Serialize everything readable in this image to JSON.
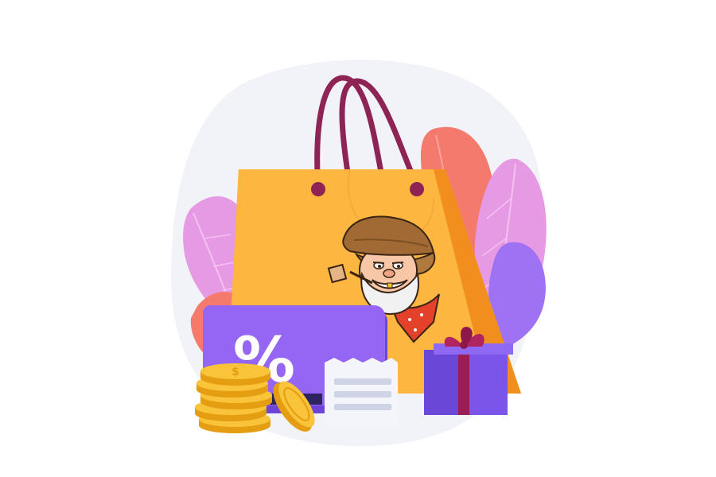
{
  "illustration": {
    "card_symbol": "%",
    "coin_symbol": "$",
    "icons": [
      "shopping-bag-icon",
      "discount-card-icon",
      "gold-coin-stack-icon",
      "receipt-icon",
      "gift-box-icon",
      "prospector-mascot-icon",
      "leaf-decoration-icon"
    ]
  },
  "colors": {
    "background_blob": "#f2f3f8",
    "bag_front": "#fdb63f",
    "bag_side": "#f59a25",
    "bag_handle": "#8e2455",
    "leaf_pink": "#ec8fe0",
    "leaf_coral": "#f47a6e",
    "leaf_violet": "#a77ef5",
    "card": "#8f63f0",
    "card_dark": "#6d44d6",
    "coin": "#f9c33a",
    "coin_edge": "#e59d11",
    "gift_box": "#7a55e8",
    "gift_ribbon": "#9b1d54",
    "receipt": "#f4f5fb",
    "receipt_lines": "#cfd3e6"
  }
}
